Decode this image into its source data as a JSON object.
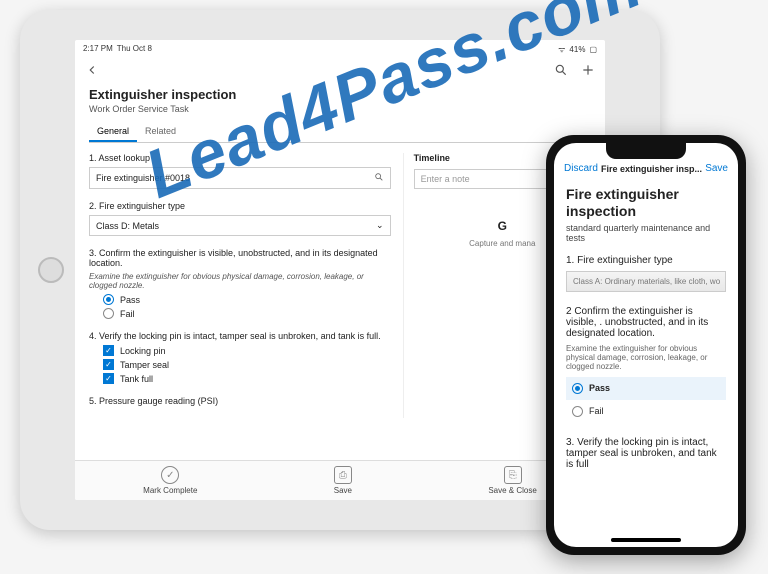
{
  "watermark": "Lead4Pass.com",
  "tablet": {
    "status": {
      "time": "2:17 PM",
      "date": "Thu Oct 8",
      "battery": "41%"
    },
    "title": "Extinguisher inspection",
    "subtitle": "Work Order Service Task",
    "tabs": {
      "general": "General",
      "related": "Related"
    },
    "q1": {
      "label": "1. Asset lookup",
      "value": "Fire extinguisher #0018"
    },
    "q2": {
      "label": "2. Fire extinguisher type",
      "value": "Class D: Metals"
    },
    "q3": {
      "label": "3. Confirm the extinguisher is visible, unobstructed, and in its designated location.",
      "note": "Examine the extinguisher for obvious physical damage, corrosion, leakage, or clogged nozzle.",
      "pass": "Pass",
      "fail": "Fail"
    },
    "q4": {
      "label": "4. Verify the locking pin is intact, tamper seal is unbroken, and tank is full.",
      "a": "Locking pin",
      "b": "Tamper seal",
      "c": "Tank full"
    },
    "q5": {
      "label": "5. Pressure gauge reading (PSI)"
    },
    "timeline": {
      "title": "Timeline",
      "placeholder": "Enter a note",
      "getstarted": "G",
      "caption": "Capture and mana"
    },
    "bottom": {
      "complete": "Mark Complete",
      "save": "Save",
      "saveClose": "Save & Close"
    }
  },
  "phone": {
    "discard": "Discard",
    "title": "Fire extinguisher insp...",
    "save": "Save",
    "h1": "Fire extinguisher inspection",
    "desc": "standard quarterly maintenance and tests",
    "q1": {
      "label": "1. Fire extinguisher type",
      "value": "Class A: Ordinary materials, like cloth, wo"
    },
    "q2": {
      "label": "2 Confirm the extinguisher is visible, . unobstructed, and in its designated location.",
      "note": "Examine the extinguisher for obvious physical damage, corrosion, leakage, or clogged nozzle.",
      "pass": "Pass",
      "fail": "Fail"
    },
    "q3": {
      "label": "3. Verify the locking pin is intact, tamper seal is unbroken, and tank is full"
    }
  }
}
